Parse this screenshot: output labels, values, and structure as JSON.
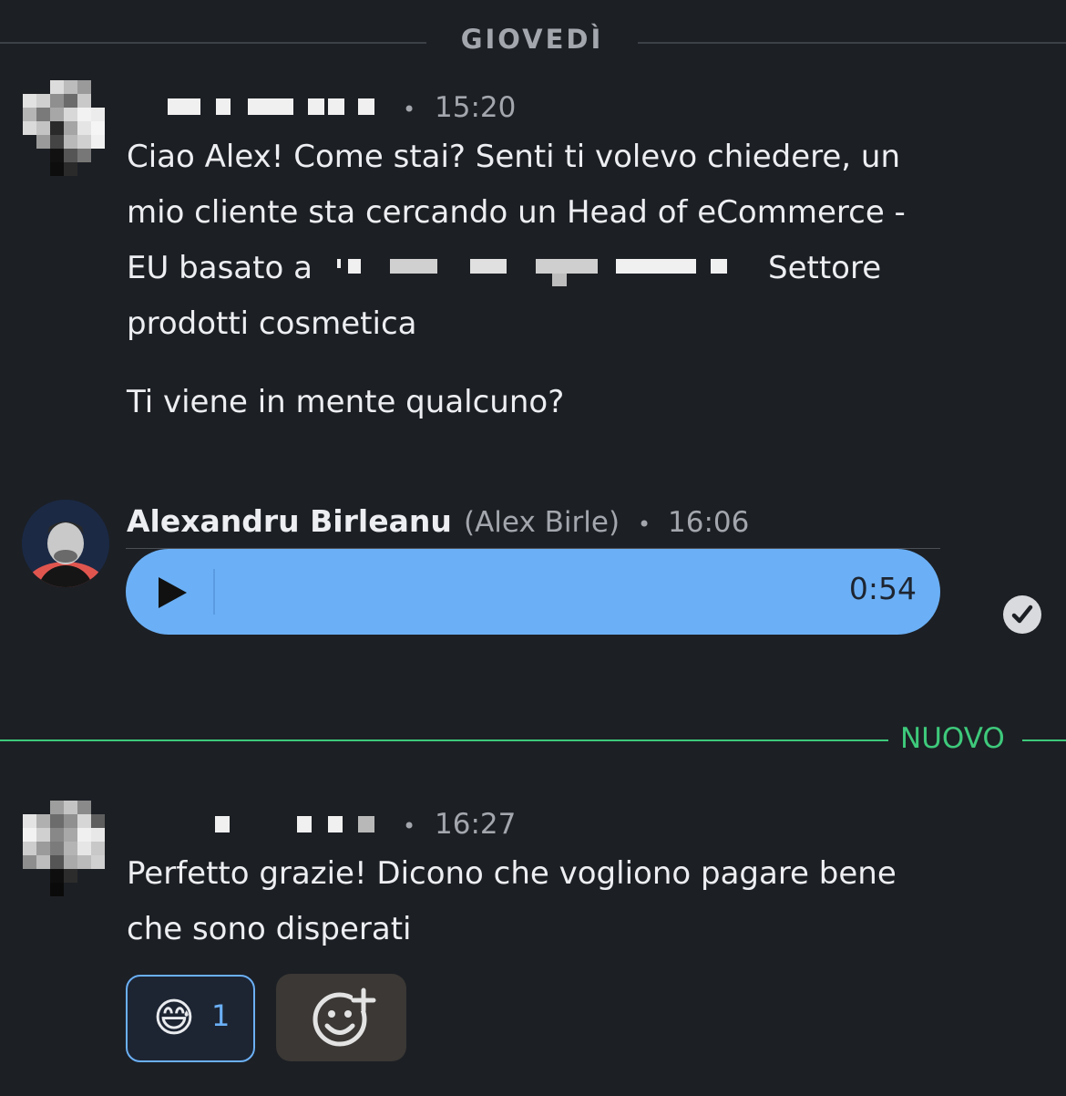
{
  "day_divider": {
    "label": "GIOVEDÌ"
  },
  "messages": [
    {
      "sender": "",
      "time": "15:20",
      "text_lines": [
        "Ciao Alex! Come stai? Senti ti volevo chiedere, un",
        "mio cliente sta cercando un Head of eCommerce -",
        "EU basato a",
        "prodotti cosmetica"
      ],
      "line3_tail": "Settore",
      "second_paragraph": "Ti viene in mente qualcuno?"
    },
    {
      "sender": "Alexandru Birleanu",
      "alias": "(Alex Birle)",
      "time": "16:06",
      "voice_duration": "0:54",
      "status_icon": "check-circle-icon"
    },
    {
      "sender": "",
      "time": "16:27",
      "text_lines": [
        "Perfetto grazie! Dicono che vogliono pagare bene",
        "che sono disperati"
      ],
      "reactions": [
        {
          "emoji": "😅",
          "count": "1"
        }
      ]
    }
  ],
  "new_divider": {
    "label": "NUOVO"
  },
  "colors": {
    "background": "#1c1f24",
    "accent_blue": "#6bb0f6",
    "new_green": "#3ec97b"
  },
  "separator": "•"
}
